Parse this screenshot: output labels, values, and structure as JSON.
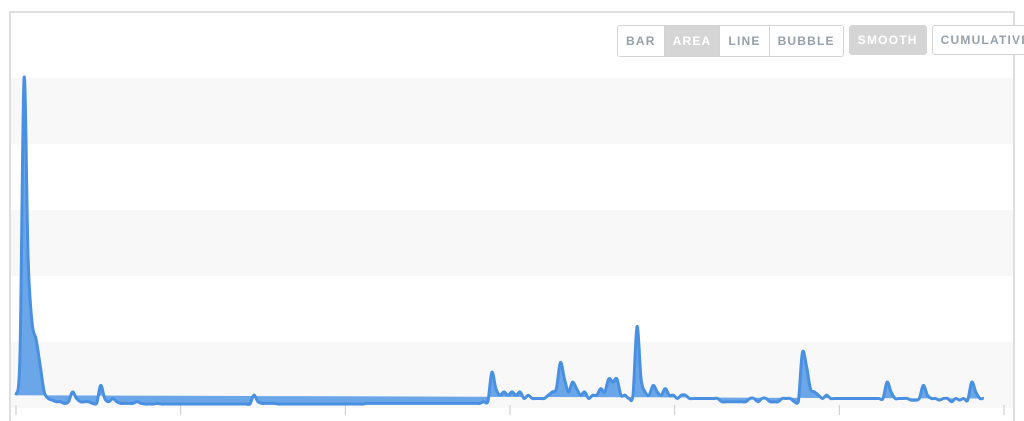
{
  "toolbar": {
    "chart_types": [
      "BAR",
      "AREA",
      "LINE",
      "BUBBLE"
    ],
    "active_type": "AREA",
    "smooth_label": "SMOOTH",
    "smooth_active": true,
    "cumulative_label": "CUMULATIVE",
    "cumulative_active": false
  },
  "colors": {
    "series_fill": "#6aa6e8",
    "series_stroke": "#4a90e2",
    "band": "#f8f8f8",
    "frame": "#dedede",
    "active_button": "#d5d5d5"
  },
  "chart_data": {
    "type": "area",
    "smooth": true,
    "title": "",
    "xlabel": "",
    "ylabel": "",
    "x_ticks_count": 7,
    "ylim": [
      0,
      100
    ],
    "x": [
      0,
      1,
      2,
      3,
      4,
      5,
      6,
      7,
      8,
      9,
      10,
      11,
      12,
      13,
      14,
      15,
      16,
      17,
      18,
      19,
      20,
      21,
      22,
      23,
      24,
      25,
      26,
      27,
      28,
      29,
      30,
      31,
      32,
      33,
      34,
      35,
      36,
      37,
      38,
      39,
      40,
      41,
      42,
      43,
      44,
      45,
      46,
      47,
      48,
      49,
      50,
      51,
      52,
      53,
      54,
      55,
      56,
      57,
      58,
      59,
      60,
      61,
      62,
      63,
      64,
      65,
      66,
      67,
      68,
      69,
      70,
      71,
      72,
      73,
      74,
      75,
      76,
      77,
      78,
      79,
      80,
      81,
      82,
      83,
      84,
      85,
      86,
      87,
      88,
      89,
      90,
      91,
      92,
      93,
      94,
      95,
      96,
      97,
      98,
      99,
      100,
      101,
      102,
      103,
      104,
      105,
      106,
      107,
      108,
      109,
      110,
      111,
      112,
      113,
      114,
      115,
      116,
      117,
      118,
      119,
      120,
      121,
      122,
      123,
      124,
      125,
      126,
      127,
      128,
      129,
      130,
      131,
      132,
      133,
      134,
      135,
      136,
      137,
      138,
      139,
      140,
      141,
      142,
      143,
      144,
      145,
      146,
      147,
      148,
      149,
      150,
      151,
      152,
      153,
      154,
      155,
      156,
      157,
      158,
      159,
      160,
      161,
      162,
      163,
      164,
      165,
      166,
      167,
      168,
      169,
      170,
      171,
      172,
      173,
      174,
      175,
      176,
      177,
      178,
      179,
      180,
      181,
      182,
      183,
      184,
      185,
      186,
      187,
      188,
      189,
      190,
      191,
      192,
      193,
      194,
      195,
      196,
      197,
      198,
      199,
      200,
      201,
      202,
      203,
      204,
      205,
      206,
      207,
      208,
      209,
      210,
      211,
      212,
      213,
      214,
      215,
      216,
      217,
      218,
      219,
      220,
      221,
      222,
      223,
      224,
      225,
      226,
      227,
      228,
      229,
      230,
      231,
      232,
      233,
      234,
      235,
      236,
      237,
      238,
      239,
      240,
      241,
      242,
      243,
      244,
      245
    ],
    "values": [
      3,
      16,
      100,
      45,
      25,
      20,
      12,
      4,
      2,
      1.5,
      1,
      1,
      0.5,
      1,
      4,
      2,
      1,
      1,
      1,
      0.5,
      0.5,
      6,
      2,
      1,
      2,
      1,
      0.5,
      0.5,
      0.5,
      0.5,
      1,
      0.5,
      0.3,
      0.3,
      0.3,
      0.5,
      0.3,
      0.3,
      0.3,
      0.3,
      0.3,
      0.3,
      0.3,
      0.3,
      0.3,
      0.3,
      0.3,
      0.3,
      0.3,
      0.3,
      0.3,
      0.3,
      0.3,
      0.3,
      0.3,
      0.3,
      0.3,
      0.3,
      0.3,
      3,
      1,
      0.5,
      0.5,
      0.5,
      0.5,
      0.3,
      0.3,
      0.3,
      0.3,
      0.3,
      0.3,
      0.3,
      0.3,
      0.3,
      0.3,
      0.3,
      0.3,
      0.3,
      0.3,
      0.3,
      0.3,
      0.3,
      0.3,
      0.3,
      0.3,
      0.3,
      0.3,
      0.5,
      0.5,
      0.5,
      0.5,
      0.5,
      0.5,
      0.5,
      0.5,
      0.5,
      0.5,
      0.5,
      0.5,
      0.5,
      0.5,
      0.5,
      0.5,
      0.5,
      0.5,
      0.5,
      0.5,
      0.5,
      0.5,
      0.5,
      0.5,
      0.5,
      0.5,
      0.5,
      0.5,
      0.5,
      1,
      1,
      10,
      5,
      3,
      4,
      3,
      4,
      3,
      4,
      2,
      3,
      2,
      2,
      2,
      2,
      3,
      4,
      5,
      13,
      8,
      4,
      7,
      5,
      3,
      4,
      2,
      3,
      3,
      5,
      4,
      8,
      7,
      8,
      3,
      3,
      2,
      3,
      24,
      8,
      4,
      3,
      6,
      4,
      3,
      5,
      3,
      3,
      2,
      3,
      3,
      2,
      2,
      2,
      2,
      2,
      2,
      2,
      2,
      1,
      1,
      1,
      1,
      1,
      1,
      1,
      2,
      2,
      1,
      2,
      2,
      1,
      1,
      1,
      2,
      2,
      2,
      1,
      1,
      16,
      12,
      5,
      4,
      3,
      2,
      3,
      2,
      2,
      2,
      2,
      2,
      2,
      2,
      2,
      2,
      2,
      2,
      2,
      2,
      2,
      7,
      4,
      2,
      2,
      2,
      2,
      1.5,
      1.5,
      2,
      6,
      3,
      2,
      2,
      1.5,
      2,
      2,
      1,
      2,
      1.5,
      2,
      1.5,
      7,
      4,
      2,
      2,
      1.5
    ]
  }
}
